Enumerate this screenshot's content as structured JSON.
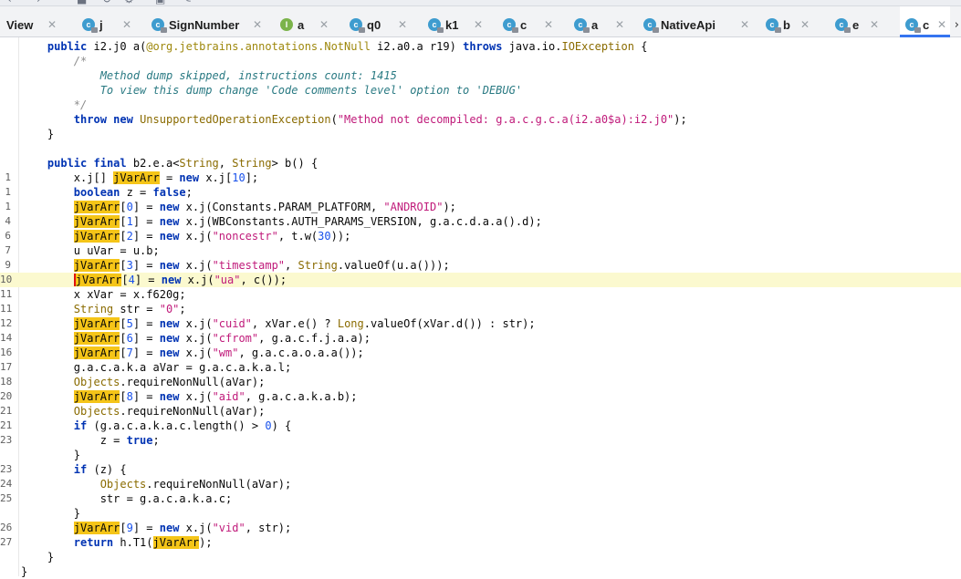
{
  "tabs": [
    {
      "label": "View",
      "icon": "none"
    },
    {
      "label": "j",
      "icon": "class-icon"
    },
    {
      "label": "SignNumber",
      "icon": "class-icon"
    },
    {
      "label": "a",
      "icon": "interface-icon"
    },
    {
      "label": "q0",
      "icon": "class-icon"
    },
    {
      "label": "k1",
      "icon": "class-icon"
    },
    {
      "label": "c",
      "icon": "class-icon"
    },
    {
      "label": "a",
      "icon": "class-icon"
    },
    {
      "label": "NativeApi",
      "icon": "class-icon"
    },
    {
      "label": "b",
      "icon": "class-icon"
    },
    {
      "label": "e",
      "icon": "class-icon"
    },
    {
      "label": "c",
      "icon": "class-icon",
      "active": true
    }
  ],
  "colors": {
    "accent": "#3574f0",
    "class_icon": "#3e9ccf",
    "interface_icon": "#7bb34a",
    "highlight_line": "#fbf9cf",
    "variable_highlight": "#f5c518"
  },
  "code_lines": [
    {
      "n": "",
      "text": "    public i2.j0 a(@org.jetbrains.annotations.NotNull i2.a0.a r19) throws java.io.IOException {"
    },
    {
      "n": "",
      "text": "        /*"
    },
    {
      "n": "",
      "text": "            Method dump skipped, instructions count: 1415"
    },
    {
      "n": "",
      "text": "            To view this dump change 'Code comments level' option to 'DEBUG'"
    },
    {
      "n": "",
      "text": "        */"
    },
    {
      "n": "",
      "text": "        throw new UnsupportedOperationException(\"Method not decompiled: g.a.c.g.c.a(i2.a0$a):i2.j0\");"
    },
    {
      "n": "",
      "text": "    }"
    },
    {
      "n": "",
      "text": ""
    },
    {
      "n": "",
      "text": "    public final b2.e.a<String, String> b() {"
    },
    {
      "n": "1",
      "text": "        x.j[] jVarArr = new x.j[10];"
    },
    {
      "n": "1",
      "text": "        boolean z = false;"
    },
    {
      "n": "1",
      "text": "        jVarArr[0] = new x.j(Constants.PARAM_PLATFORM, \"ANDROID\");"
    },
    {
      "n": "4",
      "text": "        jVarArr[1] = new x.j(WBConstants.AUTH_PARAMS_VERSION, g.a.c.d.a.a().d);"
    },
    {
      "n": "6",
      "text": "        jVarArr[2] = new x.j(\"noncestr\", t.w(30));"
    },
    {
      "n": "7",
      "text": "        u uVar = u.b;"
    },
    {
      "n": "9",
      "text": "        jVarArr[3] = new x.j(\"timestamp\", String.valueOf(u.a()));"
    },
    {
      "n": "10",
      "text": "        jVarArr[4] = new x.j(\"ua\", c());"
    },
    {
      "n": "11",
      "text": "        x xVar = x.f620g;"
    },
    {
      "n": "11",
      "text": "        String str = \"0\";"
    },
    {
      "n": "12",
      "text": "        jVarArr[5] = new x.j(\"cuid\", xVar.e() ? Long.valueOf(xVar.d()) : str);"
    },
    {
      "n": "14",
      "text": "        jVarArr[6] = new x.j(\"cfrom\", g.a.c.f.j.a.a);"
    },
    {
      "n": "16",
      "text": "        jVarArr[7] = new x.j(\"wm\", g.a.c.a.o.a.a());"
    },
    {
      "n": "17",
      "text": "        g.a.c.a.k.a aVar = g.a.c.a.k.a.l;"
    },
    {
      "n": "18",
      "text": "        Objects.requireNonNull(aVar);"
    },
    {
      "n": "20",
      "text": "        jVarArr[8] = new x.j(\"aid\", g.a.c.a.k.a.b);"
    },
    {
      "n": "21",
      "text": "        Objects.requireNonNull(aVar);"
    },
    {
      "n": "21",
      "text": "        if (g.a.c.a.k.a.c.length() > 0) {"
    },
    {
      "n": "23",
      "text": "            z = true;"
    },
    {
      "n": "",
      "text": "        }"
    },
    {
      "n": "23",
      "text": "        if (z) {"
    },
    {
      "n": "24",
      "text": "            Objects.requireNonNull(aVar);"
    },
    {
      "n": "25",
      "text": "            str = g.a.c.a.k.a.c;"
    },
    {
      "n": "",
      "text": "        }"
    },
    {
      "n": "26",
      "text": "        jVarArr[9] = new x.j(\"vid\", str);"
    },
    {
      "n": "27",
      "text": "        return h.T1(jVarArr);"
    },
    {
      "n": "",
      "text": "    }"
    },
    {
      "n": "",
      "text": "}"
    }
  ],
  "highlighted_line_index": 16,
  "highlighted_word": "jVarArr"
}
